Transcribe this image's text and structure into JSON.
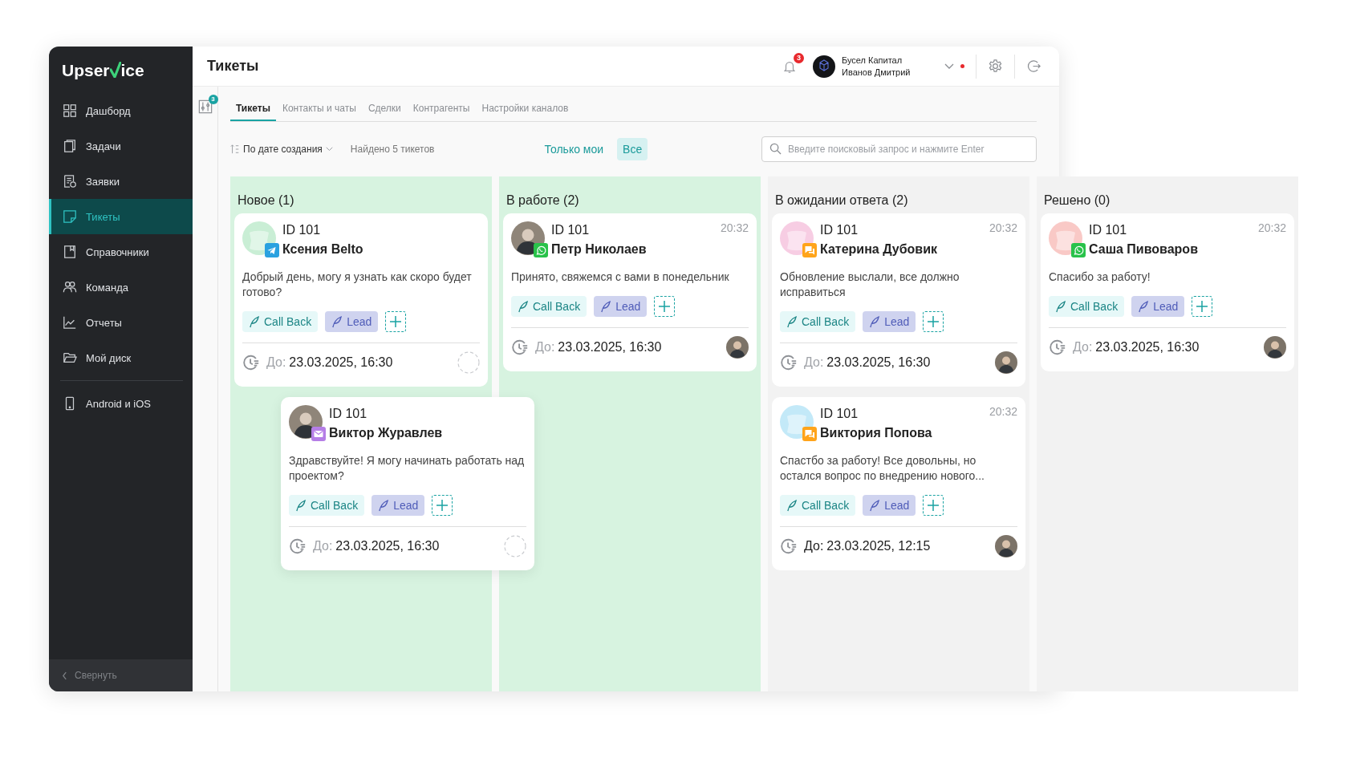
{
  "sidebar": {
    "logo_start": "Upser",
    "logo_end": "ice",
    "items": [
      {
        "label": "Дашборд",
        "selected": false
      },
      {
        "label": "Задачи",
        "selected": false
      },
      {
        "label": "Заявки",
        "selected": false
      },
      {
        "label": "Тикеты",
        "selected": true
      },
      {
        "label": "Справочники",
        "selected": false
      },
      {
        "label": "Команда",
        "selected": false
      },
      {
        "label": "Отчеты",
        "selected": false
      },
      {
        "label": "Мой диск",
        "selected": false
      }
    ],
    "extra_items": [
      {
        "label": "Android и iOS",
        "selected": false
      }
    ],
    "collapse": "Свернуть"
  },
  "header": {
    "title": "Тикеты",
    "notifications": "3",
    "company": "Бусел Капитал",
    "user": "Иванов Дмитрий",
    "alert": true
  },
  "filter_badge": "3",
  "tabs": [
    {
      "label": "Тикеты",
      "selected": true
    },
    {
      "label": "Контакты и чаты",
      "selected": false
    },
    {
      "label": "Сделки",
      "selected": false
    },
    {
      "label": "Контрагенты",
      "selected": false
    },
    {
      "label": "Настройки каналов",
      "selected": false
    }
  ],
  "toolbar": {
    "sort": "По дате создания",
    "found": "Найдено 5 тикетов",
    "scope": [
      {
        "label": "Только мои",
        "selected": false
      },
      {
        "label": "Все",
        "selected": true
      }
    ],
    "search": {
      "placeholder": "Введите поисковый запрос и нажмите Enter"
    }
  },
  "columns": [
    {
      "title": "Новое (1)",
      "color": "#d7f3e0",
      "cards": [
        {
          "id": "ID 101",
          "name": "Ксения Belto",
          "avatar": {
            "kind": "mascot",
            "color": "#c9eed5"
          },
          "kind": "telegram",
          "message": "Добрый день, могу я узнать как скоро будет готово?",
          "tags": [
            {
              "label": "Call Back",
              "kind": "callback"
            },
            {
              "label": "Lead",
              "kind": "lead"
            }
          ],
          "due_label": "До:",
          "due": "23.03.2025, 16:30",
          "overdue": false,
          "assigned": false,
          "dragging": false
        },
        {
          "id": "ID 101",
          "name": "Виктор Журавлев",
          "avatar": {
            "kind": "photo"
          },
          "kind": "email",
          "message": "Здравствуйте! Я могу начинать работать над проектом?",
          "tags": [
            {
              "label": "Call Back",
              "kind": "callback"
            },
            {
              "label": "Lead",
              "kind": "lead"
            }
          ],
          "due_label": "До:",
          "due": "23.03.2025, 16:30",
          "overdue": false,
          "assigned": false,
          "dragging": true
        }
      ]
    },
    {
      "title": "В работе (2)",
      "color": "#d7f3e0",
      "cards": [
        {
          "id": "ID 101",
          "name": "Петр Николаев",
          "time": "20:32",
          "avatar": {
            "kind": "photo"
          },
          "kind": "whatsapp",
          "message": "Принято, свяжемся с вами в понедельник",
          "tags": [
            {
              "label": "Call Back",
              "kind": "callback"
            },
            {
              "label": "Lead",
              "kind": "lead"
            }
          ],
          "due_label": "До:",
          "due": "23.03.2025, 16:30",
          "overdue": false,
          "assigned": true,
          "dragging": false
        }
      ]
    },
    {
      "title": "В ожидании ответа (2)",
      "color": "#f2f2f2",
      "cards": [
        {
          "id": "ID 101",
          "name": "Катерина Дубовик",
          "time": "20:32",
          "avatar": {
            "kind": "mascot",
            "color": "#f7cde3"
          },
          "kind": "chat",
          "message": "Обновление выслали, все должно исправиться",
          "tags": [
            {
              "label": "Call Back",
              "kind": "callback"
            },
            {
              "label": "Lead",
              "kind": "lead"
            }
          ],
          "due_label": "До:",
          "due": "23.03.2025, 16:30",
          "overdue": false,
          "assigned": true,
          "dragging": false
        },
        {
          "id": "ID 101",
          "name": "Виктория Попова",
          "time": "20:32",
          "avatar": {
            "kind": "mascot",
            "color": "#c3e9f8"
          },
          "kind": "chat",
          "message": "Спастбо за работу! Все довольны, но остался вопрос по внедрению нового...",
          "tags": [
            {
              "label": "Call Back",
              "kind": "callback"
            },
            {
              "label": "Lead",
              "kind": "lead"
            }
          ],
          "due_label": "До:",
          "due": "23.03.2025, 12:15",
          "overdue": true,
          "assigned": true,
          "dragging": false
        }
      ]
    },
    {
      "title": "Решено (0)",
      "color": "#f2f2f2",
      "cards": [
        {
          "id": "ID 101",
          "name": "Саша Пивоваров",
          "time": "20:32",
          "avatar": {
            "kind": "mascot",
            "color": "#f9c9c6"
          },
          "kind": "whatsapp",
          "message": "Спасибо за работу!",
          "tags": [
            {
              "label": "Call Back",
              "kind": "callback"
            },
            {
              "label": "Lead",
              "kind": "lead"
            }
          ],
          "due_label": "До:",
          "due": "23.03.2025, 16:30",
          "overdue": false,
          "assigned": true,
          "dragging": false
        }
      ]
    }
  ]
}
